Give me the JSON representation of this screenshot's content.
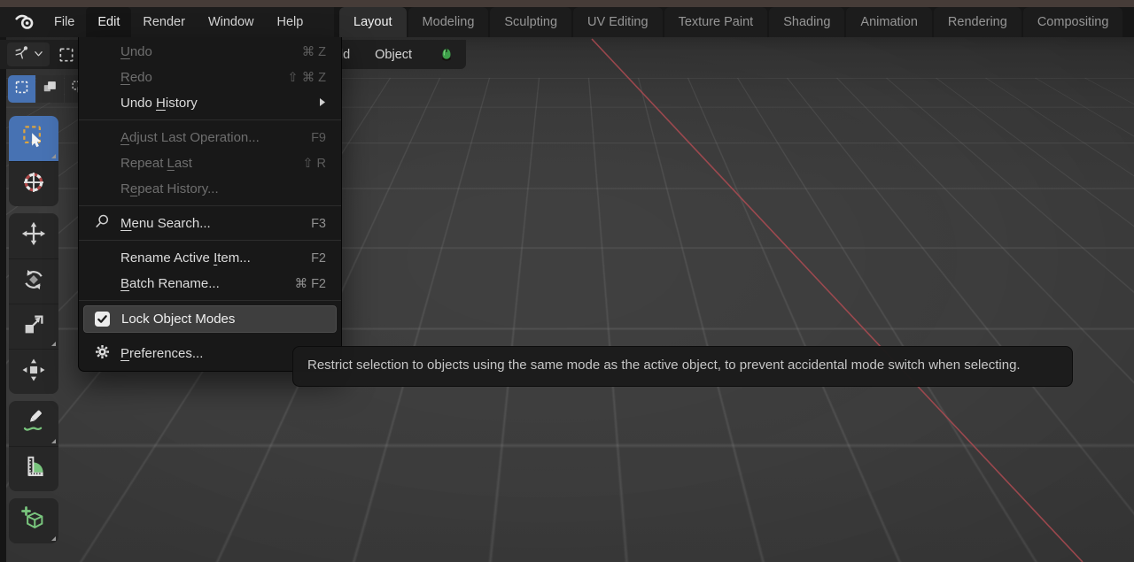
{
  "colors": {
    "accent_blue": "#4772b3",
    "axis_red": "#ad4b52",
    "tool_green": "#79c57d",
    "dash_orange": "#dda43e",
    "menu_highlight": "#3e3e3e"
  },
  "menubar": {
    "logo": "blender-logo-icon",
    "items": [
      {
        "label": "File",
        "active": false
      },
      {
        "label": "Edit",
        "active": true
      },
      {
        "label": "Render",
        "active": false
      },
      {
        "label": "Window",
        "active": false
      },
      {
        "label": "Help",
        "active": false
      }
    ]
  },
  "workspace_tabs": {
    "active": "Layout",
    "items": [
      "Layout",
      "Modeling",
      "Sculpting",
      "UV Editing",
      "Texture Paint",
      "Shading",
      "Animation",
      "Rendering",
      "Compositing"
    ]
  },
  "viewport_header": {
    "mode_button_icon": "object-mode-icon",
    "select_box_icon": "select-box-icon",
    "add_menu_partial": "dd",
    "object_menu": "Object",
    "green_blob_icon": "green-blob-icon"
  },
  "select_mode_buttons": [
    {
      "name": "select-mode-set",
      "icon": "sel-set",
      "active": true
    },
    {
      "name": "select-mode-extend",
      "icon": "sel-extend",
      "active": false
    },
    {
      "name": "select-mode-subtract",
      "icon": "sel-subtract",
      "active": false
    }
  ],
  "toolbar": {
    "groups": [
      [
        {
          "name": "select-box-tool",
          "icon": "tool-select",
          "active": true,
          "subtools": true
        },
        {
          "name": "cursor-tool",
          "icon": "tool-cursor",
          "active": false,
          "subtools": false
        }
      ],
      [
        {
          "name": "move-tool",
          "icon": "tool-move",
          "active": false,
          "subtools": false
        },
        {
          "name": "rotate-tool",
          "icon": "tool-rotate",
          "active": false,
          "subtools": false
        },
        {
          "name": "scale-tool",
          "icon": "tool-scale",
          "active": false,
          "subtools": true
        },
        {
          "name": "transform-tool",
          "icon": "tool-transform",
          "active": false,
          "subtools": false
        }
      ],
      [
        {
          "name": "annotate-tool",
          "icon": "tool-annotate",
          "active": false,
          "subtools": true
        },
        {
          "name": "measure-tool",
          "icon": "tool-measure",
          "active": false,
          "subtools": false
        }
      ],
      [
        {
          "name": "add-cube-tool",
          "icon": "tool-addcube",
          "active": false,
          "subtools": true
        }
      ]
    ]
  },
  "edit_menu": {
    "items": [
      {
        "label": "Undo",
        "accel_idx": 0,
        "shortcut": "⌘ Z",
        "disabled": true
      },
      {
        "label": "Redo",
        "accel_idx": 0,
        "shortcut": "⇧ ⌘ Z",
        "disabled": true
      },
      {
        "label": "Undo History",
        "accel_idx": 5,
        "submenu": true,
        "disabled": false
      },
      {
        "sep": true
      },
      {
        "label": "Adjust Last Operation...",
        "accel_idx": 0,
        "shortcut": "F9",
        "disabled": true
      },
      {
        "label": "Repeat Last",
        "accel_idx": 7,
        "shortcut": "⇧ R",
        "disabled": true
      },
      {
        "label": "Repeat History...",
        "accel_idx": 1,
        "disabled": true
      },
      {
        "sep": true
      },
      {
        "label": "Menu Search...",
        "accel_idx": 0,
        "icon": "search",
        "shortcut": "F3",
        "disabled": false
      },
      {
        "sep": true
      },
      {
        "label": "Rename Active Item...",
        "accel_idx": 14,
        "shortcut": "F2",
        "disabled": false
      },
      {
        "label": "Batch Rename...",
        "accel_idx": 0,
        "shortcut": "⌘ F2",
        "disabled": false
      },
      {
        "sep": true
      },
      {
        "label": "Lock Object Modes",
        "checkbox": true,
        "checked": true,
        "highlighted": true,
        "disabled": false
      },
      {
        "label": "Preferences...",
        "accel_idx": 0,
        "icon": "gear",
        "disabled": false,
        "gap_before": true
      }
    ]
  },
  "tooltip": {
    "text": "Restrict selection to objects using the same mode as the active object, to prevent accidental mode switch when selecting."
  }
}
